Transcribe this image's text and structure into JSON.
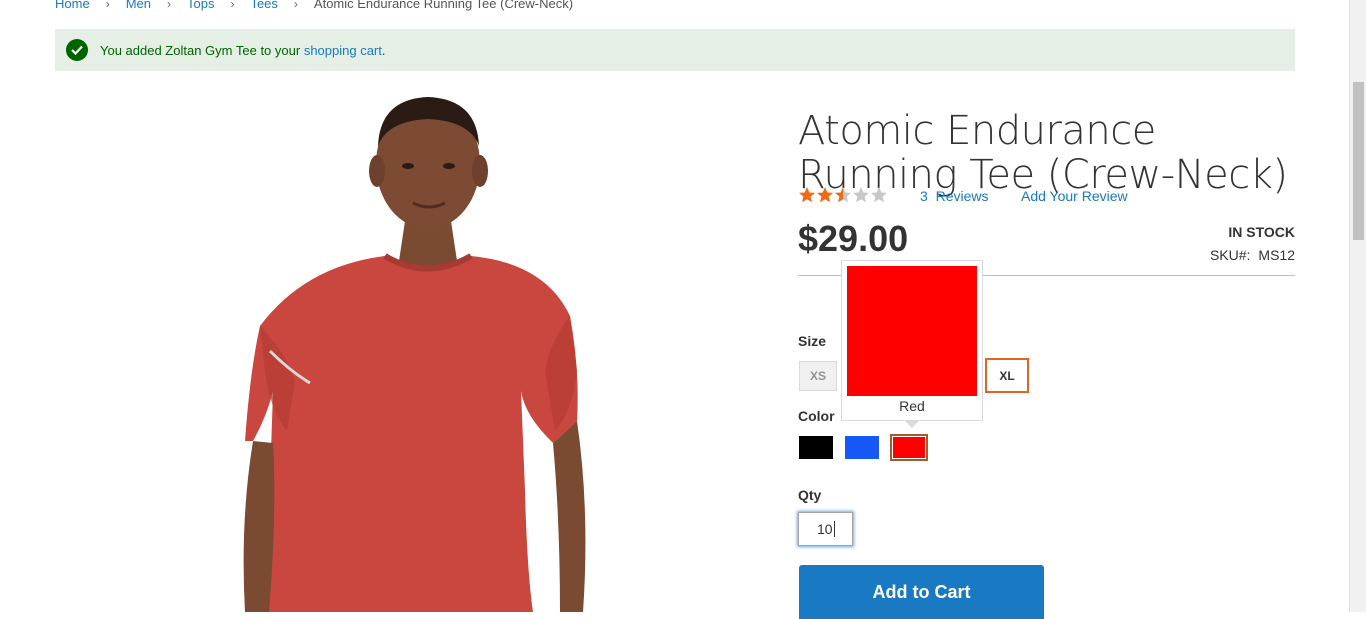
{
  "breadcrumbs": {
    "items": [
      "Home",
      "Men",
      "Tops",
      "Tees"
    ],
    "current": "Atomic Endurance Running Tee (Crew-Neck)"
  },
  "message": {
    "prefix": "You added Zoltan Gym Tee to your ",
    "link": "shopping cart",
    "suffix": ".",
    "icon": "check-icon"
  },
  "product": {
    "title": "Atomic Endurance Running Tee (Crew-Neck)",
    "rating": {
      "filled_fraction": 0.6,
      "stars": 5
    },
    "reviews_count": "3",
    "reviews_label": "Reviews",
    "add_review": "Add Your Review",
    "price": "$29.00",
    "stock": "In stock",
    "sku_label": "SKU#:",
    "sku": "MS12"
  },
  "options": {
    "size_label": "Size",
    "sizes": [
      "XS",
      "XL"
    ],
    "selected_size": "XL",
    "color_label": "Color",
    "colors": [
      {
        "name": "Black",
        "hex": "#000000"
      },
      {
        "name": "Blue",
        "hex": "#1857f7"
      },
      {
        "name": "Red",
        "hex": "#ff0000"
      }
    ],
    "selected_color": "Red",
    "tooltip_label": "Red"
  },
  "qty": {
    "label": "Qty",
    "value": "10"
  },
  "add_to_cart": "Add to Cart",
  "colors": {
    "link": "#1979c3",
    "success_bg": "#e5efe5",
    "success_text": "#006400",
    "star": "#ef6a13",
    "selected_border": "#e06521"
  }
}
